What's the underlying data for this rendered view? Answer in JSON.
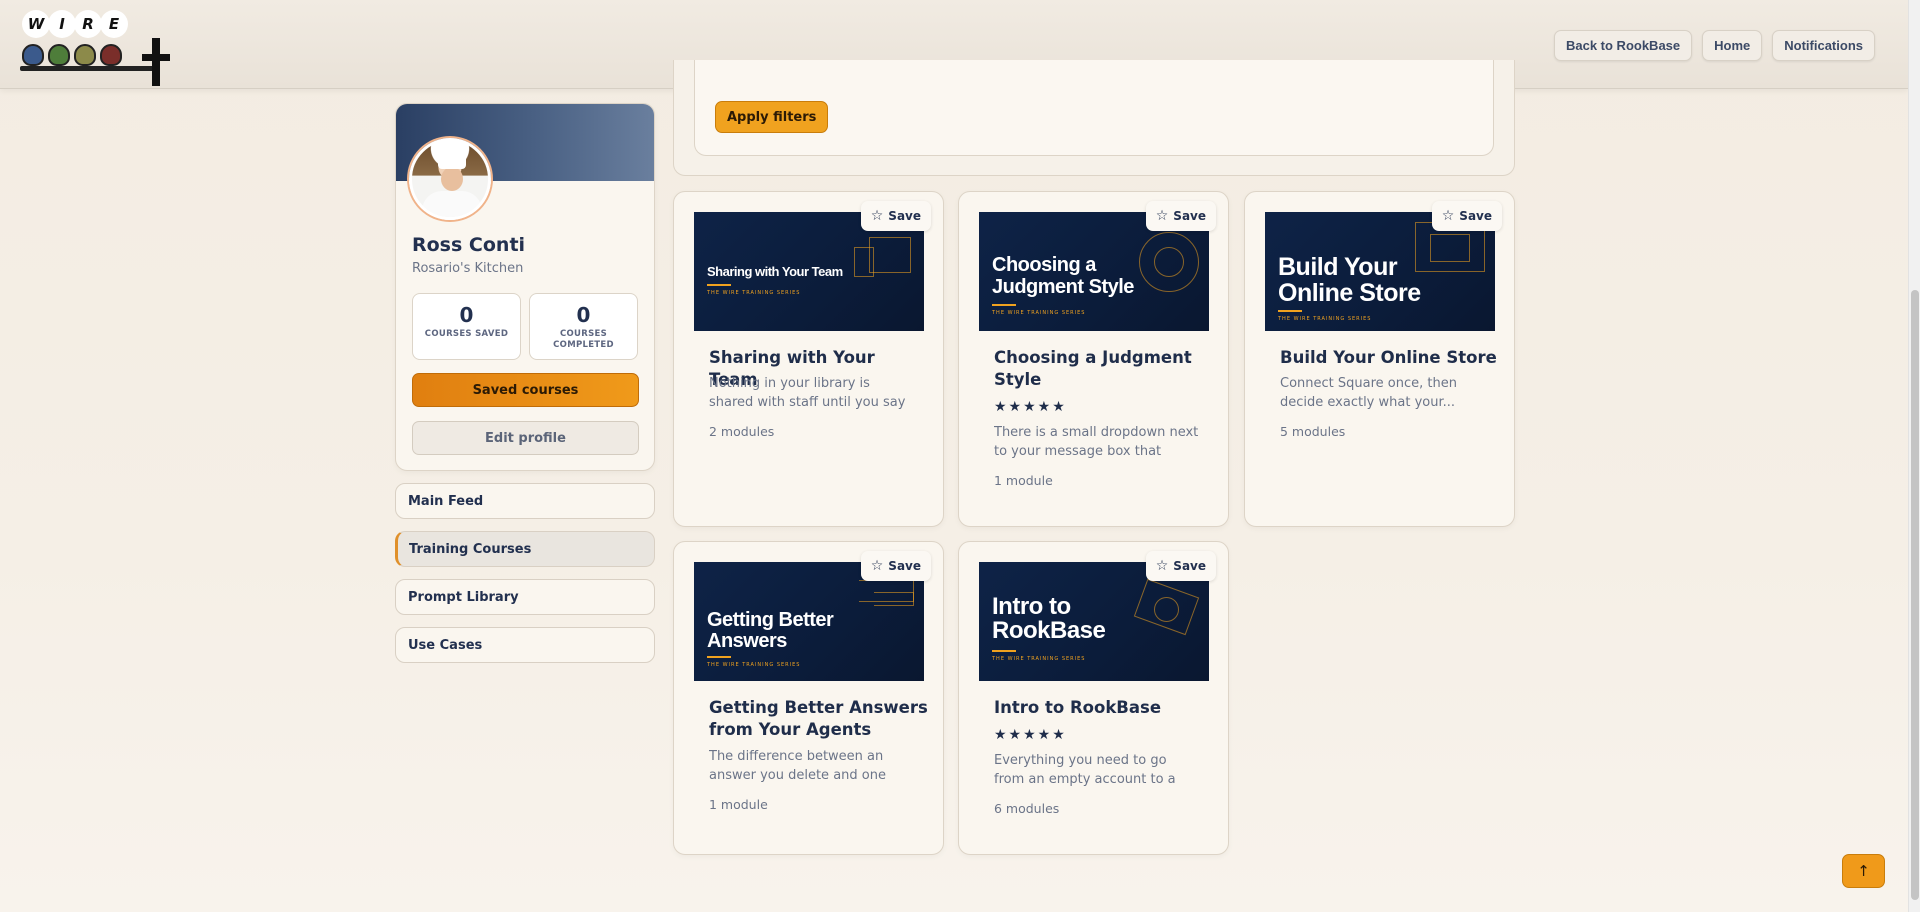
{
  "header": {
    "logo_letters": [
      "W",
      "I",
      "R",
      "E"
    ],
    "nav": {
      "back_label": "Back to RookBase",
      "home_label": "Home",
      "notifications_label": "Notifications"
    }
  },
  "profile": {
    "name": "Ross Conti",
    "organization": "Rosario's Kitchen",
    "stats": {
      "saved_count": "0",
      "saved_label": "COURSES SAVED",
      "completed_count": "0",
      "completed_label": "COURSES COMPLETED"
    },
    "saved_courses_label": "Saved courses",
    "edit_profile_label": "Edit profile"
  },
  "sidebar": {
    "items": [
      {
        "label": "Main Feed",
        "active": false
      },
      {
        "label": "Training Courses",
        "active": true
      },
      {
        "label": "Prompt Library",
        "active": false
      },
      {
        "label": "Use Cases",
        "active": false
      }
    ]
  },
  "filters": {
    "apply_label": "Apply filters"
  },
  "courses": [
    {
      "title": "Sharing with Your Team",
      "thumb_title": "Sharing with Your Team",
      "rating": null,
      "description": "Nothing in your library is shared with staff until you say so. How...",
      "modules": "2 modules",
      "save_label": "Save"
    },
    {
      "title": "Choosing a Judgment Style",
      "thumb_title": "Choosing a Judgment Style",
      "rating": "★★★★★",
      "description": "There is a small dropdown next to your message box that most...",
      "modules": "1 module",
      "save_label": "Save"
    },
    {
      "title": "Build Your Online Store",
      "thumb_title": "Build Your Online Store",
      "rating": null,
      "description": "Connect Square once, then decide exactly what your...",
      "modules": "5 modules",
      "save_label": "Save"
    },
    {
      "title": "Getting Better Answers from Your Agents",
      "thumb_title": "Getting Better Answers",
      "rating": null,
      "description": "The difference between an answer you delete and one you...",
      "modules": "1 module",
      "save_label": "Save"
    },
    {
      "title": "Intro to RookBase",
      "thumb_title": "Intro to RookBase",
      "rating": "★★★★★",
      "description": "Everything you need to go from an empty account to a working...",
      "modules": "6 modules",
      "save_label": "Save"
    }
  ],
  "scroll_top_label": "↑",
  "colors": {
    "accent": "#f09a1a",
    "navy": "#1f2d4a",
    "thumb_bg": "#0e2347"
  }
}
